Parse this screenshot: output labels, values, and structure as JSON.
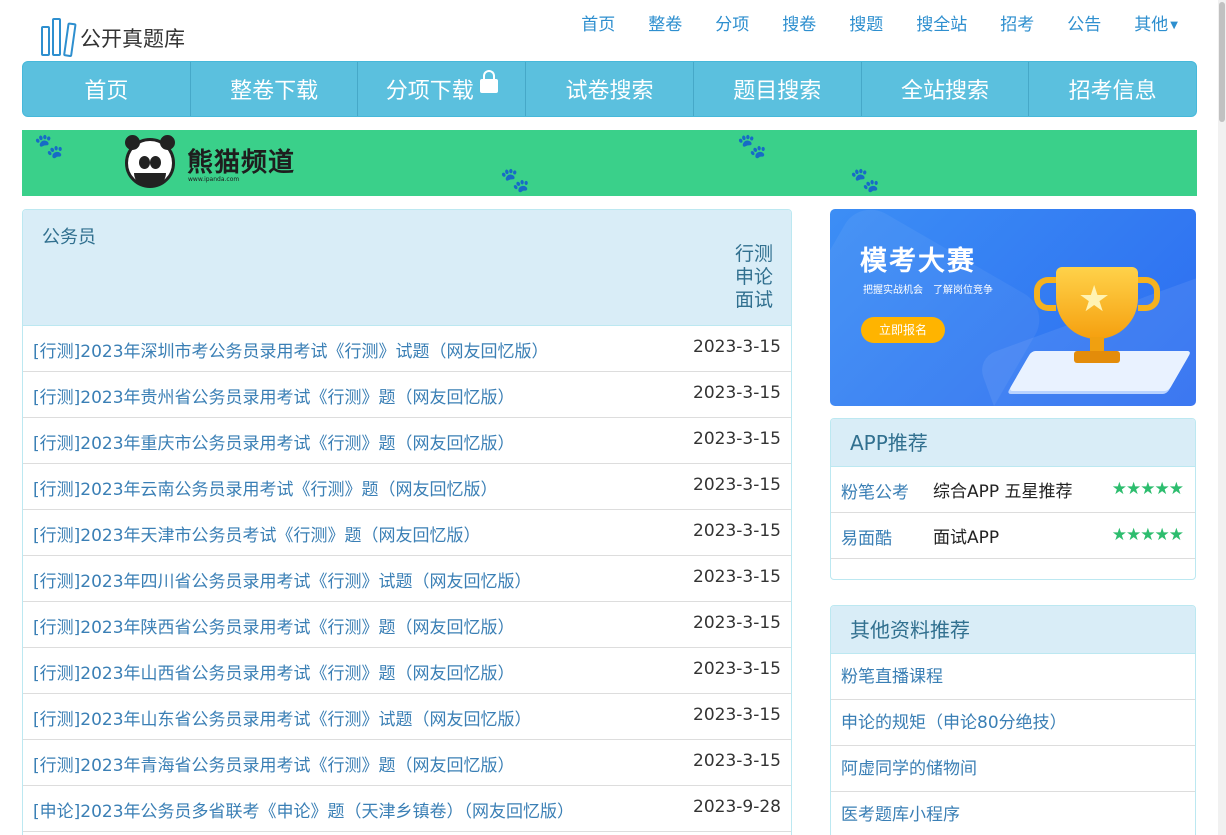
{
  "site": {
    "name": "公开真题库"
  },
  "top_nav": [
    "首页",
    "整卷",
    "分项",
    "搜卷",
    "搜题",
    "搜全站",
    "招考",
    "公告",
    "其他"
  ],
  "main_nav": [
    "首页",
    "整卷下载",
    "分项下载",
    "试卷搜索",
    "题目搜索",
    "全站搜索",
    "招考信息"
  ],
  "banner": {
    "title": "熊猫频道",
    "subtitle": "www.ipanda.com"
  },
  "exam_panel": {
    "title": "公务员",
    "tags": [
      "行测",
      "申论",
      "面试"
    ],
    "rows": [
      {
        "title": "[行测]2023年深圳市考公务员录用考试《行测》试题（网友回忆版）",
        "date": "2023-3-15"
      },
      {
        "title": "[行测]2023年贵州省公务员录用考试《行测》题（网友回忆版）",
        "date": "2023-3-15"
      },
      {
        "title": "[行测]2023年重庆市公务员录用考试《行测》题（网友回忆版）",
        "date": "2023-3-15"
      },
      {
        "title": "[行测]2023年云南公务员录用考试《行测》题（网友回忆版）",
        "date": "2023-3-15"
      },
      {
        "title": "[行测]2023年天津市公务员考试《行测》题（网友回忆版）",
        "date": "2023-3-15"
      },
      {
        "title": "[行测]2023年四川省公务员录用考试《行测》试题（网友回忆版）",
        "date": "2023-3-15"
      },
      {
        "title": "[行测]2023年陕西省公务员录用考试《行测》题（网友回忆版）",
        "date": "2023-3-15"
      },
      {
        "title": "[行测]2023年山西省公务员录用考试《行测》题（网友回忆版）",
        "date": "2023-3-15"
      },
      {
        "title": "[行测]2023年山东省公务员录用考试《行测》试题（网友回忆版）",
        "date": "2023-3-15"
      },
      {
        "title": "[行测]2023年青海省公务员录用考试《行测》题（网友回忆版）",
        "date": "2023-3-15"
      },
      {
        "title": "[申论]2023年公务员多省联考《申论》题（天津乡镇卷）（网友回忆版）",
        "date": "2023-9-28"
      }
    ]
  },
  "ad": {
    "title": "模考大赛",
    "subtitle": "把握实战机会　了解岗位竞争",
    "button": "立即报名"
  },
  "app_panel": {
    "title": "APP推荐",
    "items": [
      {
        "name": "粉笔公考",
        "desc": "综合APP 五星推荐",
        "stars": "★★★★★"
      },
      {
        "name": "易面酷",
        "desc": "面试APP",
        "stars": "★★★★★"
      }
    ]
  },
  "resource_panel": {
    "title": "其他资料推荐",
    "items": [
      "粉笔直播课程",
      "申论的规矩（申论80分绝技）",
      "阿虚同学的储物间",
      "医考题库小程序"
    ]
  }
}
